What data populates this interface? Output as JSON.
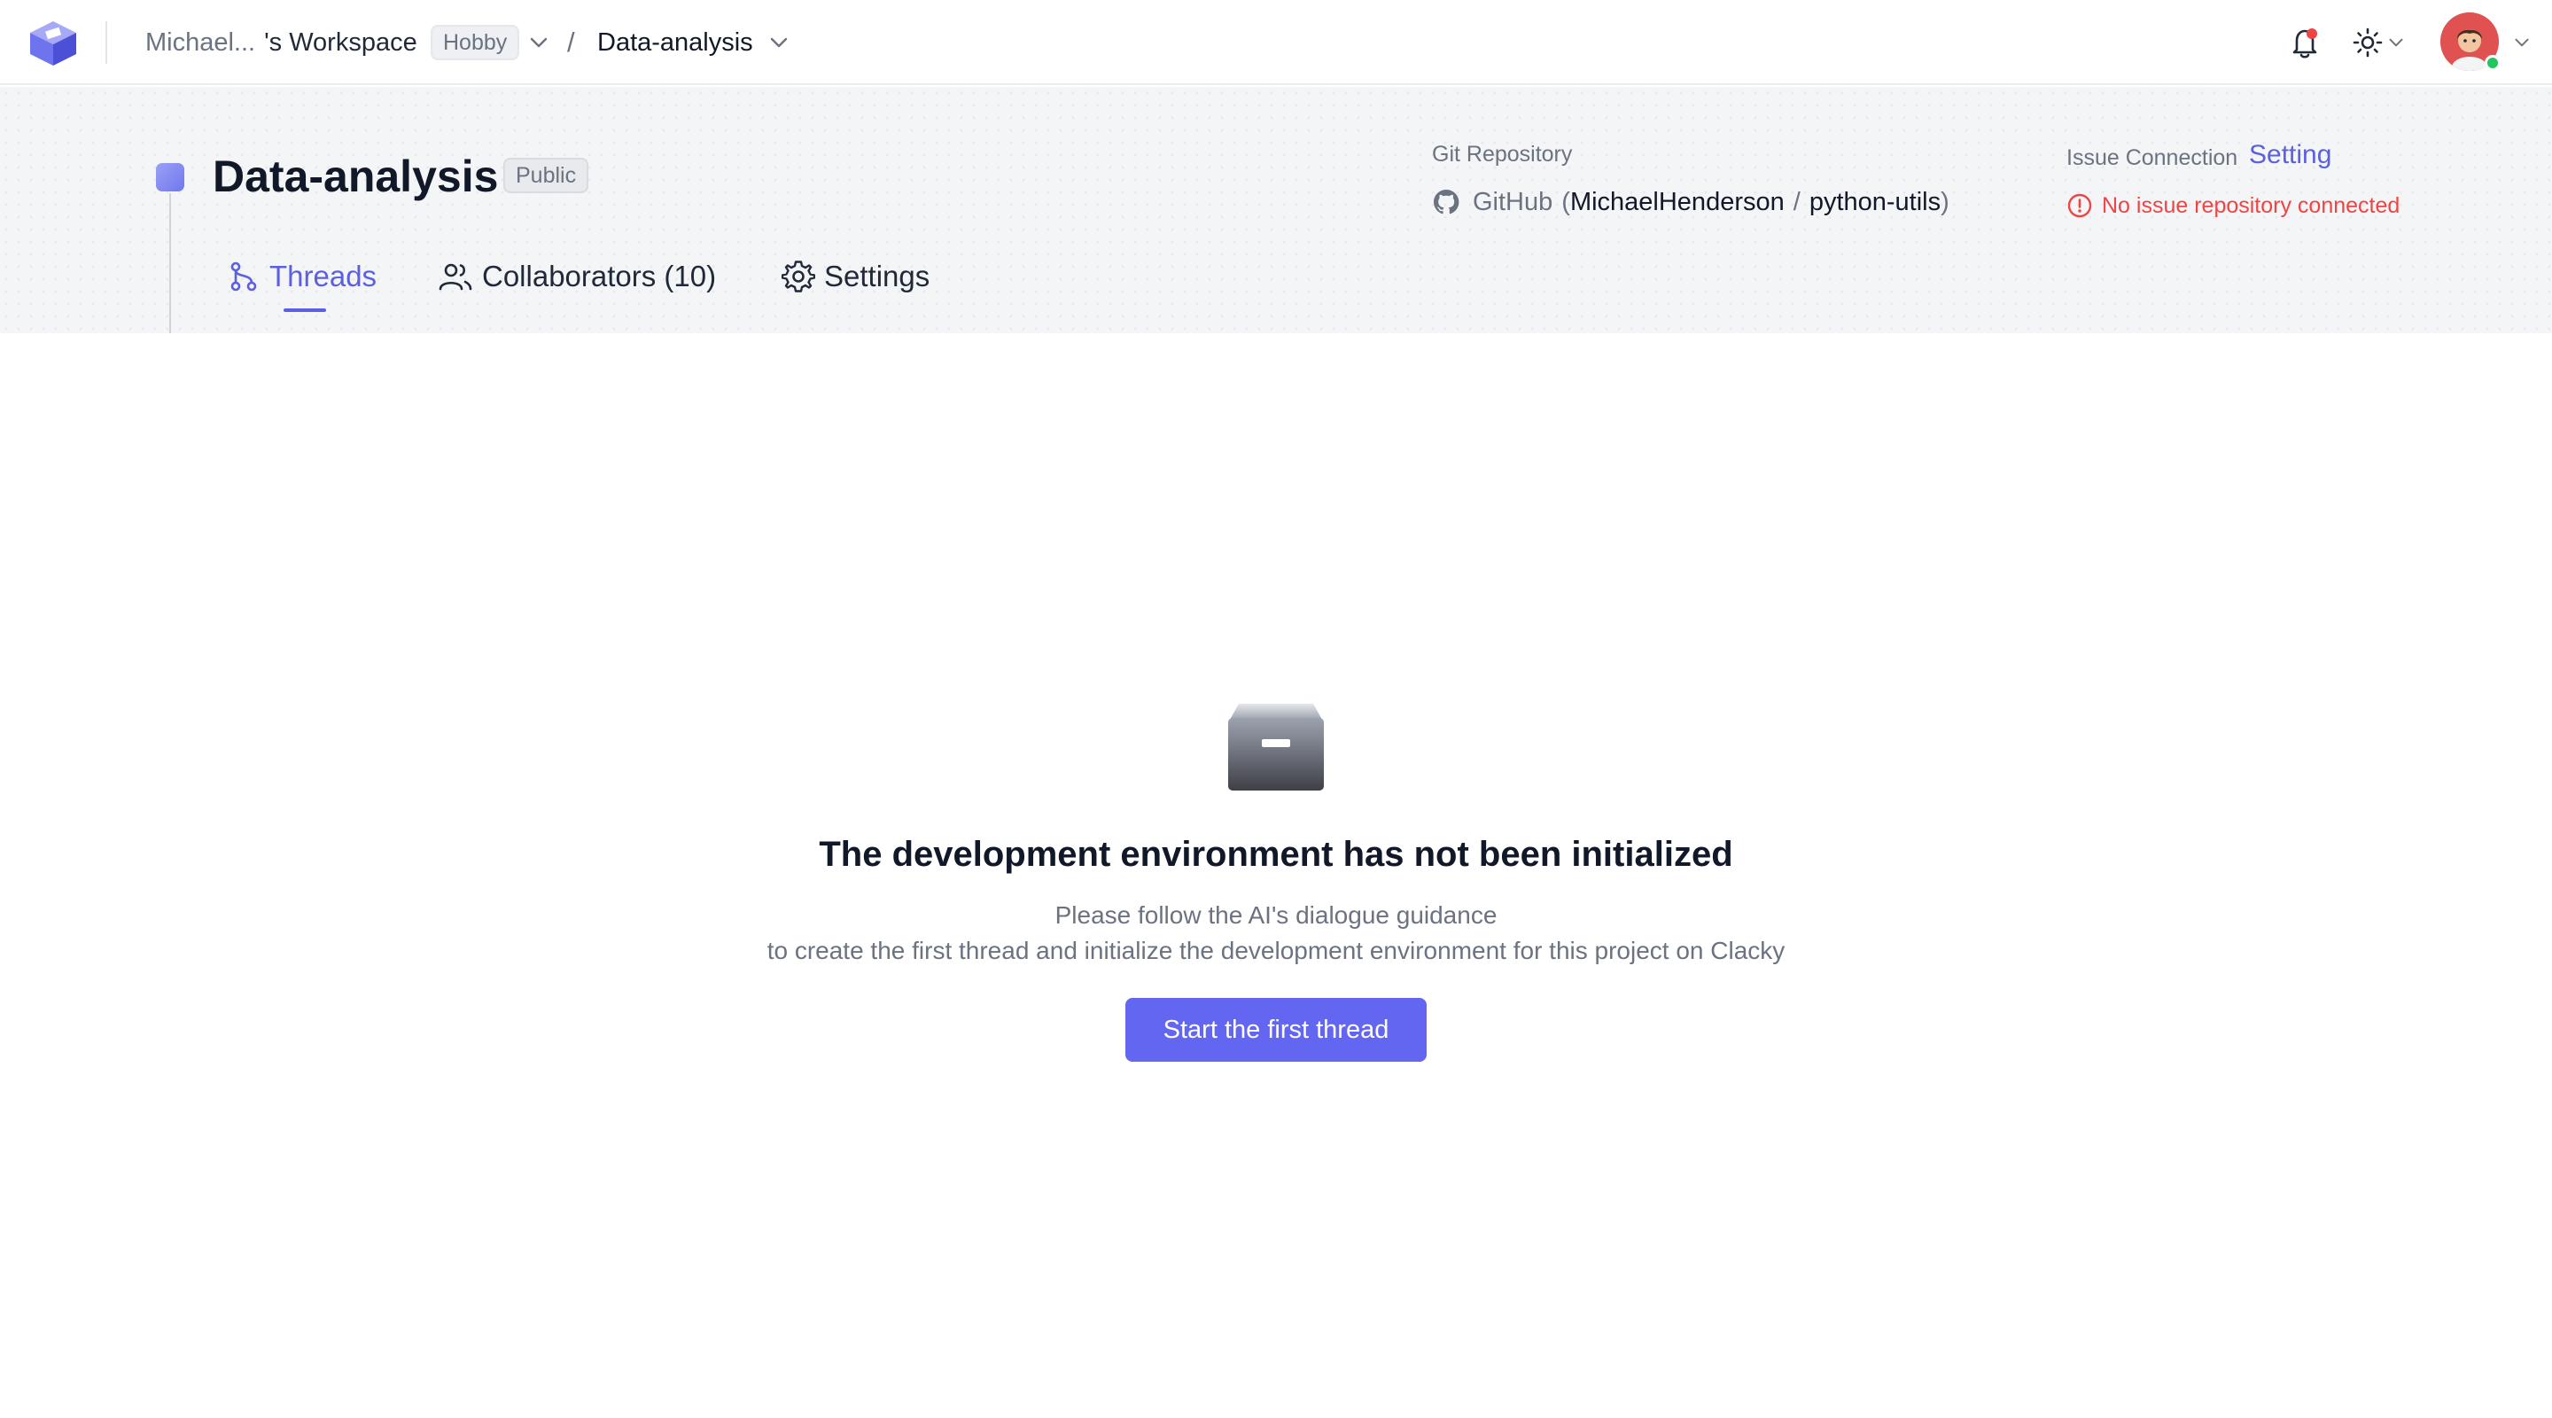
{
  "colors": {
    "accent": "#5b5fe0",
    "button": "#6366f1",
    "error": "#ef4444",
    "online": "#22c55e"
  },
  "topbar": {
    "workspace_owner": "Michael...",
    "workspace_suffix": "'s Workspace",
    "plan_badge": "Hobby",
    "separator": "/",
    "project": "Data-analysis",
    "icons": [
      "app-logo-icon",
      "chevron-down-icon",
      "bell-icon",
      "sun-icon",
      "avatar"
    ]
  },
  "project": {
    "title": "Data-analysis",
    "visibility": "Public",
    "tabs": [
      {
        "label": "Threads",
        "icon": "git-branch-icon",
        "active": true
      },
      {
        "label": "Collaborators (10)",
        "icon": "users-icon",
        "active": false
      },
      {
        "label": "Settings",
        "icon": "gear-icon",
        "active": false
      }
    ],
    "git": {
      "label": "Git Repository",
      "provider": "GitHub",
      "open_paren": "(",
      "owner": "MichaelHenderson",
      "slash": "/",
      "repo": "python-utils",
      "close_paren": ")"
    },
    "issue": {
      "label": "Issue Connection",
      "setting_link": "Setting",
      "warning": "No issue repository connected"
    }
  },
  "empty_state": {
    "title": "The development environment has not been initialized",
    "line1": "Please follow the AI's dialogue guidance",
    "line2": "to create the first thread and initialize the development environment for this project on Clacky",
    "button": "Start the first thread"
  }
}
